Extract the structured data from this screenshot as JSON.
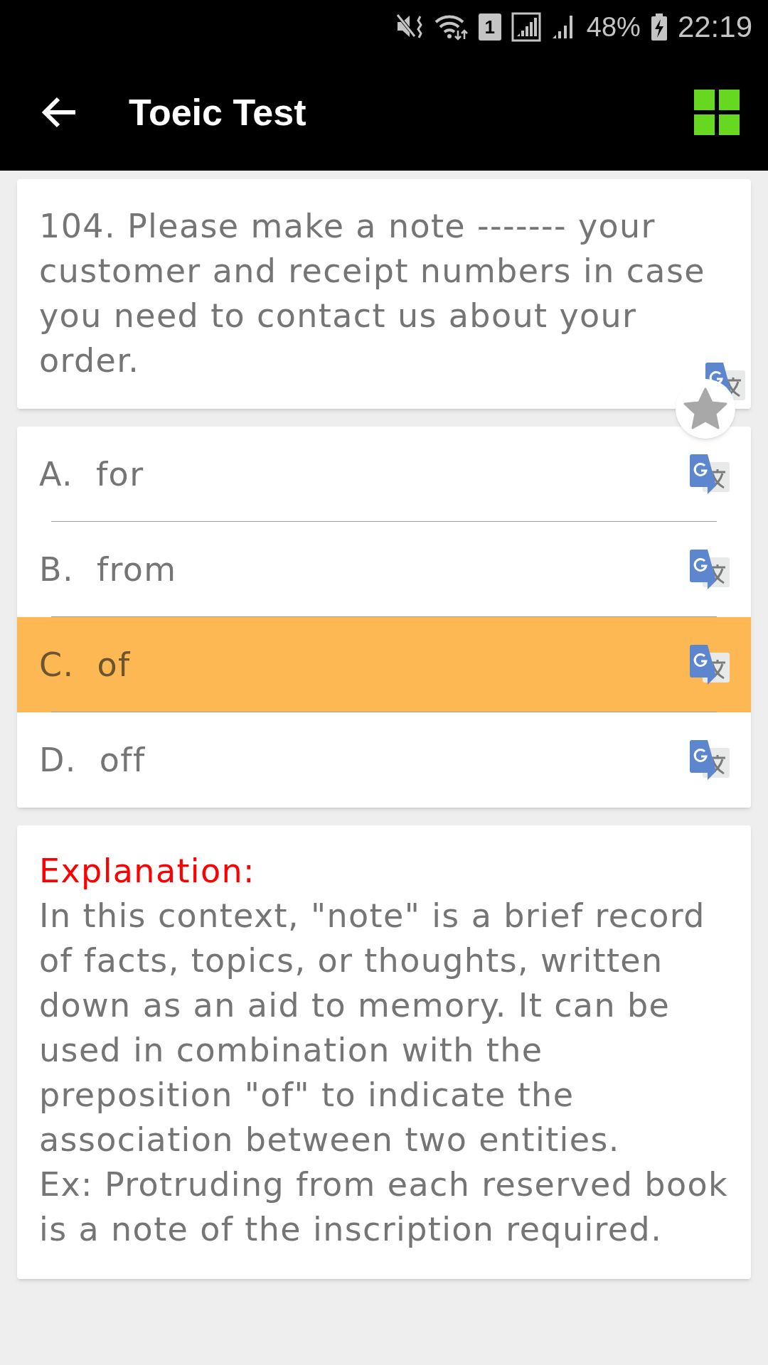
{
  "status_bar": {
    "sim_slot": "1",
    "battery": "48%",
    "time": "22:19"
  },
  "app_bar": {
    "title": "Toeic Test"
  },
  "question": {
    "text": "104. Please make a note ------- your customer and receipt numbers in case you need to contact us about your order.",
    "starred": false
  },
  "options": [
    {
      "letter": "A.",
      "text": "for",
      "selected": false
    },
    {
      "letter": "B.",
      "text": "from",
      "selected": false
    },
    {
      "letter": "C.",
      "text": "of",
      "selected": true
    },
    {
      "letter": "D.",
      "text": "off",
      "selected": false
    }
  ],
  "explanation": {
    "heading": "Explanation:",
    "lines": [
      "In this context, \"note\" is a brief record of facts, topics, or thoughts, written down as an aid to memory. It can be used in combination with the preposition \"of\" to indicate the association between two entities.",
      "Ex: Protruding from each reserved book is a note of the inscription required."
    ]
  }
}
